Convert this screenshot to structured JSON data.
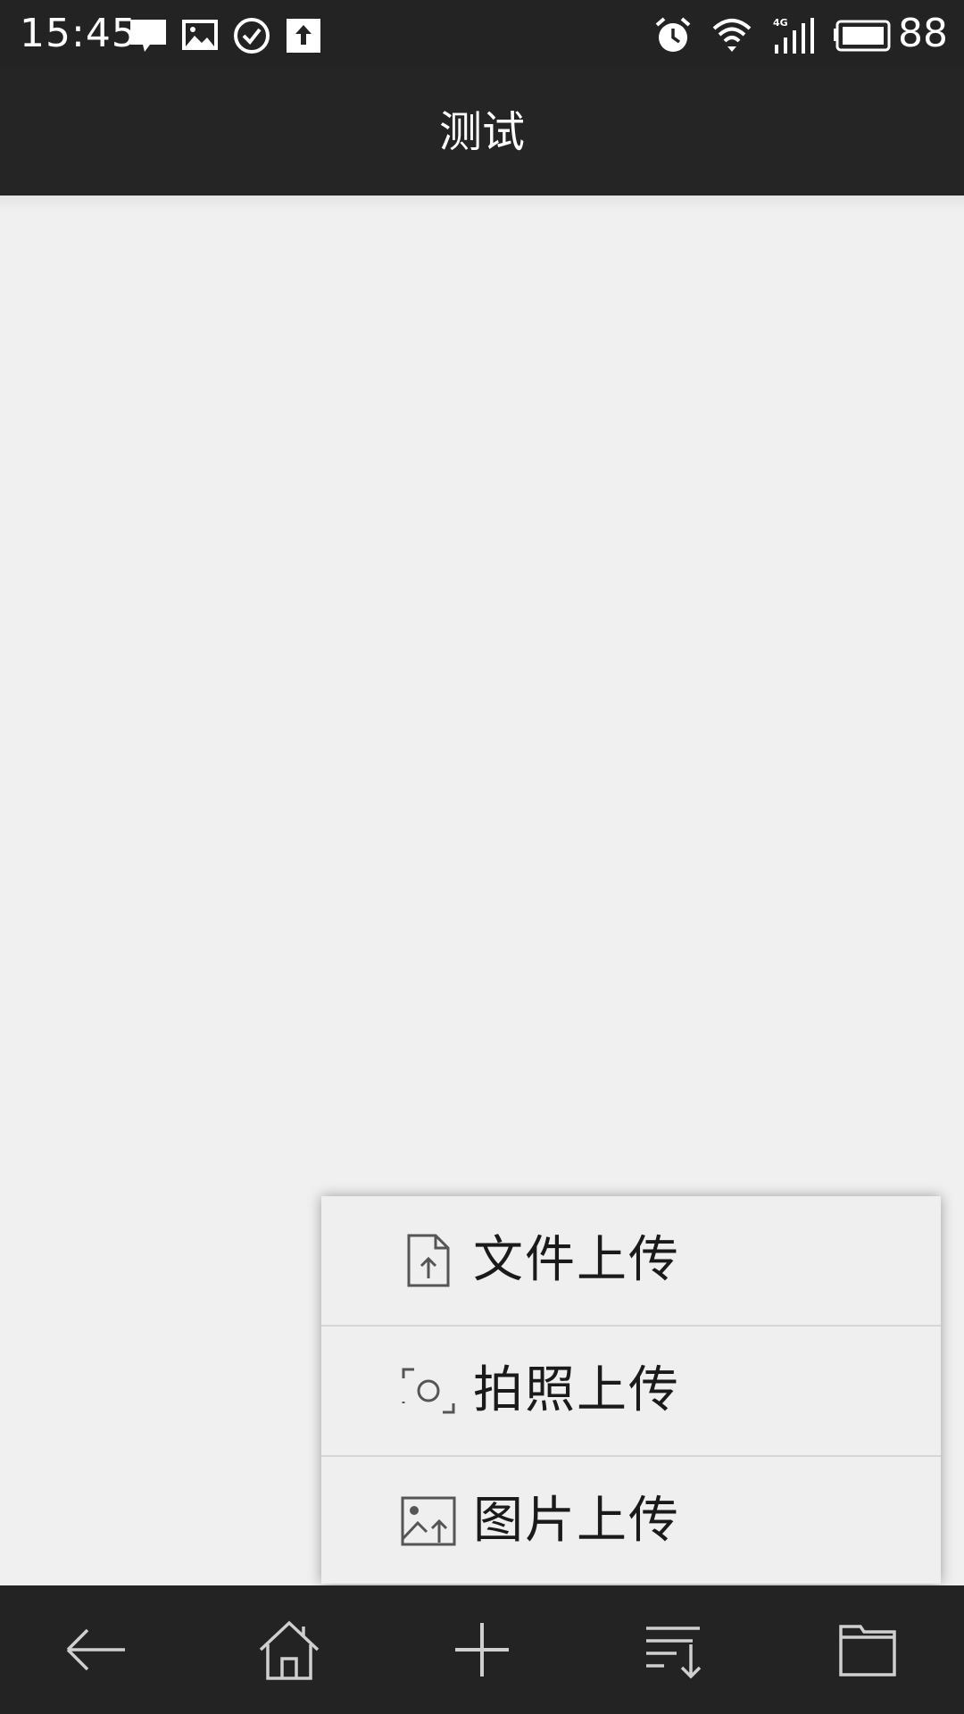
{
  "status_bar": {
    "time": "15:45",
    "battery": "88",
    "left_icons": [
      "message-icon",
      "image-icon",
      "check-circle-icon",
      "upload-icon"
    ],
    "right_icons": [
      "alarm-icon",
      "wifi-icon",
      "signal-4g-icon",
      "battery-icon"
    ],
    "network_label": "4G"
  },
  "app_bar": {
    "title": "测试"
  },
  "popup_menu": {
    "items": [
      {
        "label": "文件上传",
        "icon": "file-upload-icon"
      },
      {
        "label": "拍照上传",
        "icon": "camera-icon"
      },
      {
        "label": "图片上传",
        "icon": "image-upload-icon"
      }
    ]
  },
  "bottom_nav": {
    "buttons": [
      "back-icon",
      "home-icon",
      "plus-icon",
      "sort-icon",
      "folder-icon"
    ]
  },
  "colors": {
    "bar_background": "#232323",
    "content_background": "#f0f0f0",
    "menu_background": "#efefef",
    "icon_gray": "#cfcfcf"
  }
}
